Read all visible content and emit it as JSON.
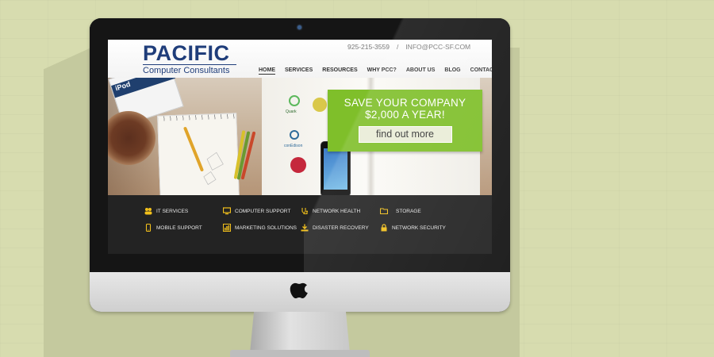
{
  "site": {
    "logo": {
      "main": "PACIFIC",
      "sub": "Computer Consultants"
    },
    "contact": {
      "phone": "925-215-3559",
      "separator": "/",
      "email": "INFO@PCC-SF.COM"
    },
    "nav": [
      {
        "label": "HOME",
        "active": true
      },
      {
        "label": "SERVICES"
      },
      {
        "label": "RESOURCES"
      },
      {
        "label": "WHY PCC?"
      },
      {
        "label": "ABOUT US"
      },
      {
        "label": "BLOG"
      },
      {
        "label": "CONTACT"
      }
    ],
    "promo": {
      "line1": "SAVE YOUR COMPANY",
      "line2": "$2,000 A YEAR!",
      "button": "find out more"
    },
    "hero_labels": {
      "magazine": "iPod",
      "brand1": "Quark",
      "brand2": "conEdison",
      "brand3": "LG"
    },
    "services": [
      {
        "label": "IT SERVICES",
        "icon": "users-icon"
      },
      {
        "label": "COMPUTER SUPPORT",
        "icon": "monitor-icon"
      },
      {
        "label": "NETWORK HEALTH",
        "icon": "stethoscope-icon"
      },
      {
        "label": "STORAGE",
        "icon": "folder-icon"
      },
      {
        "label": "MOBILE SUPPORT",
        "icon": "mobile-icon"
      },
      {
        "label": "MARKETING SOLUTIONS",
        "icon": "bar-chart-icon"
      },
      {
        "label": "DISASTER RECOVERY",
        "icon": "download-icon"
      },
      {
        "label": "NETWORK SECURITY",
        "icon": "lock-icon"
      }
    ]
  },
  "colors": {
    "background": "#d7dcaf",
    "logo_blue": "#1f3d7a",
    "promo_green": "#7fbf2a",
    "services_bar": "#232323",
    "icon_yellow": "#f2c01b"
  }
}
